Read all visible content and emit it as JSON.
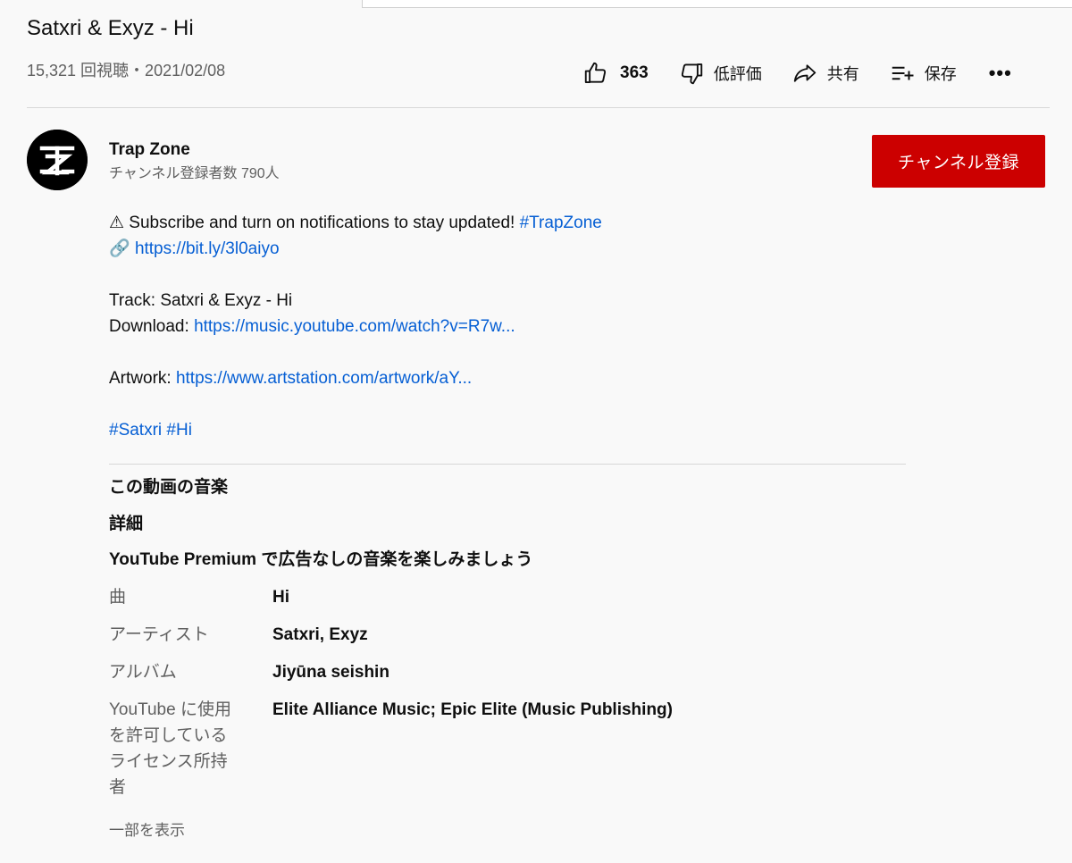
{
  "video": {
    "title": "Satxri & Exyz - Hi",
    "views_date": "15,321 回視聴・2021/02/08"
  },
  "actions": {
    "like_count": "363",
    "dislike_label": "低評価",
    "share_label": "共有",
    "save_label": "保存",
    "more_label": "•••"
  },
  "channel": {
    "name": "Trap Zone",
    "subscribers": "チャンネル登録者数 790人",
    "subscribe_label": "チャンネル登録"
  },
  "description": {
    "line1_text": "⚠ Subscribe and turn on notifications to stay updated! ",
    "line1_hashtag": "#TrapZone",
    "line2_emoji": "🔗 ",
    "line2_link": "https://bit.ly/3l0aiyo",
    "track_line": "Track: Satxri & Exyz - Hi",
    "download_label": "Download: ",
    "download_link": "https://music.youtube.com/watch?v=R7w...",
    "artwork_label": "Artwork: ",
    "artwork_link": "https://www.artstation.com/artwork/aY...",
    "hashtag1": "#Satxri",
    "hashtag2": "#Hi"
  },
  "music": {
    "heading": "この動画の音楽",
    "details_label": "詳細",
    "premium_text": "YouTube Premium で広告なしの音楽を楽しみましょう",
    "rows": [
      {
        "label": "曲",
        "value": "Hi"
      },
      {
        "label": "アーティスト",
        "value": "Satxri, Exyz"
      },
      {
        "label": "アルバム",
        "value": "Jiyūna seishin"
      },
      {
        "label": "YouTube に使用を許可しているライセンス所持者",
        "value": "Elite Alliance Music; Epic Elite (Music Publishing)"
      }
    ]
  },
  "show_less": "一部を表示",
  "icons": {
    "like": "thumbs-up-icon",
    "dislike": "thumbs-down-icon",
    "share": "share-arrow-icon",
    "save": "playlist-add-icon",
    "avatar": "trap-zone-logo"
  },
  "colors": {
    "subscribe_bg": "#cc0000",
    "link": "#065fd4",
    "secondary_text": "#606060",
    "background": "#f9f9f9"
  }
}
